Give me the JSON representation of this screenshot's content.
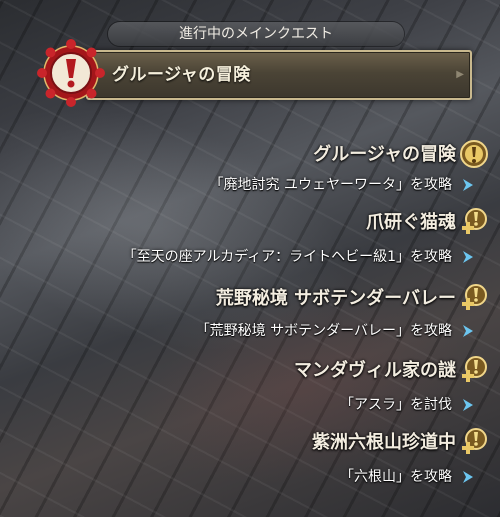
{
  "main_quest": {
    "header": "進行中のメインクエスト",
    "title": "グルージャの冒険",
    "emblem_icon": "red-gear-exclamation-icon",
    "accent": "#c9b98e"
  },
  "quests": [
    {
      "title": "グルージャの冒険",
      "objective": "「廃地討究 ユウェヤーワータ」を攻略",
      "icon": "gold-exclamation-marker-icon"
    },
    {
      "title": "爪研ぐ猫魂",
      "objective": "「至天の座アルカディア：ライトヘビー級1」を攻略",
      "icon": "gold-plus-marker-icon"
    },
    {
      "title": "荒野秘境 サボテンダーバレー",
      "objective": "「荒野秘境 サボテンダーバレー」を攻略",
      "icon": "gold-plus-marker-icon"
    },
    {
      "title": "マンダヴィル家の謎",
      "objective": "「アスラ」を討伐",
      "icon": "gold-plus-marker-icon"
    },
    {
      "title": "紫洲六根山珍道中",
      "objective": "「六根山」を攻略",
      "icon": "gold-plus-marker-icon"
    }
  ],
  "colors": {
    "objective_arrow": "#6cc6f0",
    "marker_gold": "#d9b95c"
  }
}
